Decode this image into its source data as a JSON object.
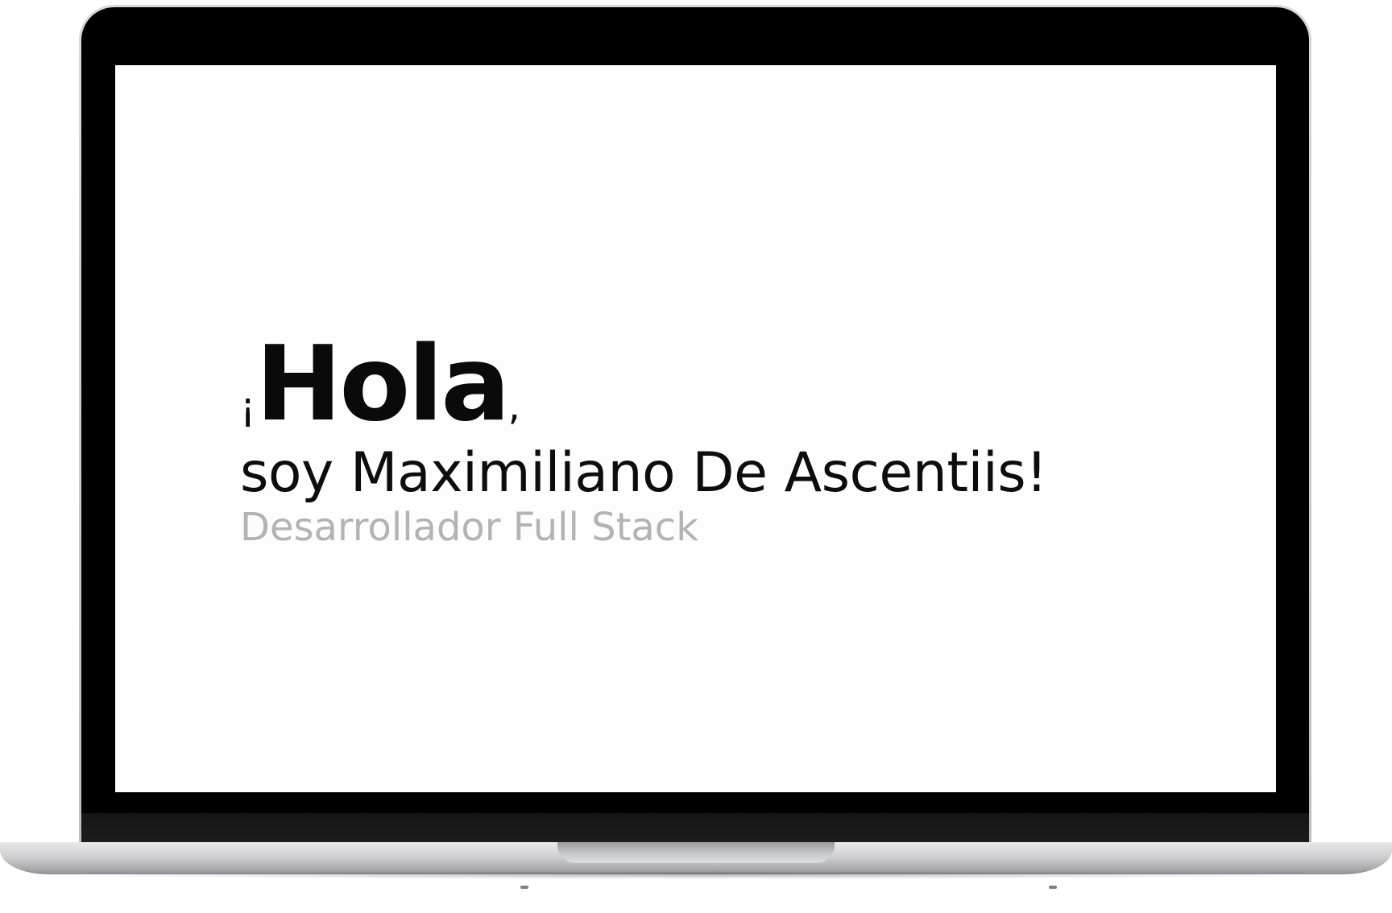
{
  "hero": {
    "open_mark": "¡",
    "greeting_word": "Hola",
    "comma": ",",
    "name_line": "soy Maximiliano De Ascentiis!",
    "role": "Desarrollador Full Stack"
  },
  "colors": {
    "screen_background": "#fdfdfd",
    "heading_text": "#0a0a0a",
    "role_text": "#b3b3b3",
    "bezel": "#000000"
  }
}
